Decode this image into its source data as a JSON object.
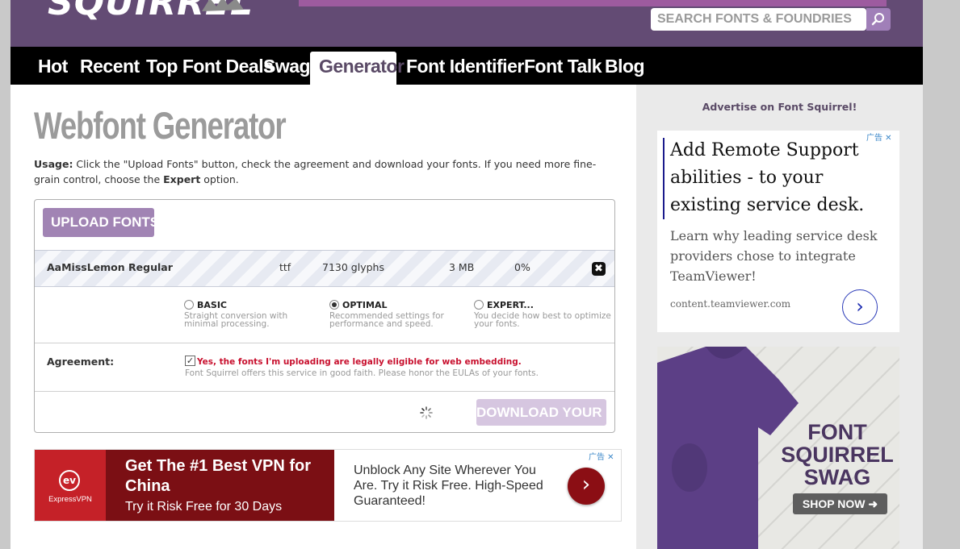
{
  "header": {
    "logo_text": "SQUIRREL"
  },
  "nav": {
    "items": [
      {
        "label": "Hot"
      },
      {
        "label": "Recent"
      },
      {
        "label": "Top Font Deals"
      },
      {
        "label": "Swag"
      },
      {
        "label": "Generator",
        "active": true
      },
      {
        "label": "Font Identifier"
      },
      {
        "label": "Font Talk"
      },
      {
        "label": "Blog"
      }
    ],
    "search_placeholder": "SEARCH FONTS & FOUNDRIES",
    "search_icon": "search-icon"
  },
  "page": {
    "title": "Webfont Generator",
    "usage_label": "Usage:",
    "usage_text_1": " Click the \"Upload Fonts\" button, check the agreement and download your fonts. If you need more fine-grain control, choose the ",
    "usage_expert": "Expert",
    "usage_text_2": " option."
  },
  "generator": {
    "upload_label": "UPLOAD FONTS",
    "upload_icon": "arrow-up-icon",
    "font_row": {
      "name": "AaMissLemon Regular",
      "format": "ttf",
      "glyphs": "7130 glyphs",
      "size": "3 MB",
      "progress": "0%"
    },
    "modes": [
      {
        "label": "BASIC",
        "desc": "Straight conversion with minimal processing.",
        "selected": false
      },
      {
        "label": "OPTIMAL",
        "desc": "Recommended settings for performance and speed.",
        "selected": true
      },
      {
        "label": "EXPERT...",
        "desc": "You decide how best to optimize your fonts.",
        "selected": false
      }
    ],
    "agreement_label": "Agreement:",
    "agreement_text": "Yes, the fonts I'm uploading are legally eligible for web embedding.",
    "agreement_sub": "Font Squirrel offers this service in good faith. Please honor the EULAs of your fonts.",
    "agreement_checked": true,
    "download_label": "DOWNLOAD YOUR KIT"
  },
  "vpn_ad": {
    "adchoice": "广告",
    "brand": "ExpressVPN",
    "headline": "Get The #1 Best VPN for China",
    "sub": "Try it Risk Free for 30 Days",
    "body": "Unblock Any Site Wherever You Are. Try it Risk Free. High-Speed Guaranteed!"
  },
  "sidebar": {
    "advertise": "Advertise on Font Squirrel!",
    "tv_ad": {
      "adchoice": "广告",
      "headline": "Add Remote Support abilities - to your existing service desk.",
      "body": "Learn why leading service desk providers chose to integrate TeamViewer!",
      "url": "content.teamviewer.com"
    },
    "swag_ad": {
      "title_1": "FONT",
      "title_2": "SQUIRREL",
      "title_3": "SWAG",
      "button": "SHOP NOW"
    }
  },
  "colors": {
    "header_purple": "#634b74",
    "accent_purple": "#a184b4",
    "nav_black": "#000000",
    "error_red": "#c8102e"
  }
}
